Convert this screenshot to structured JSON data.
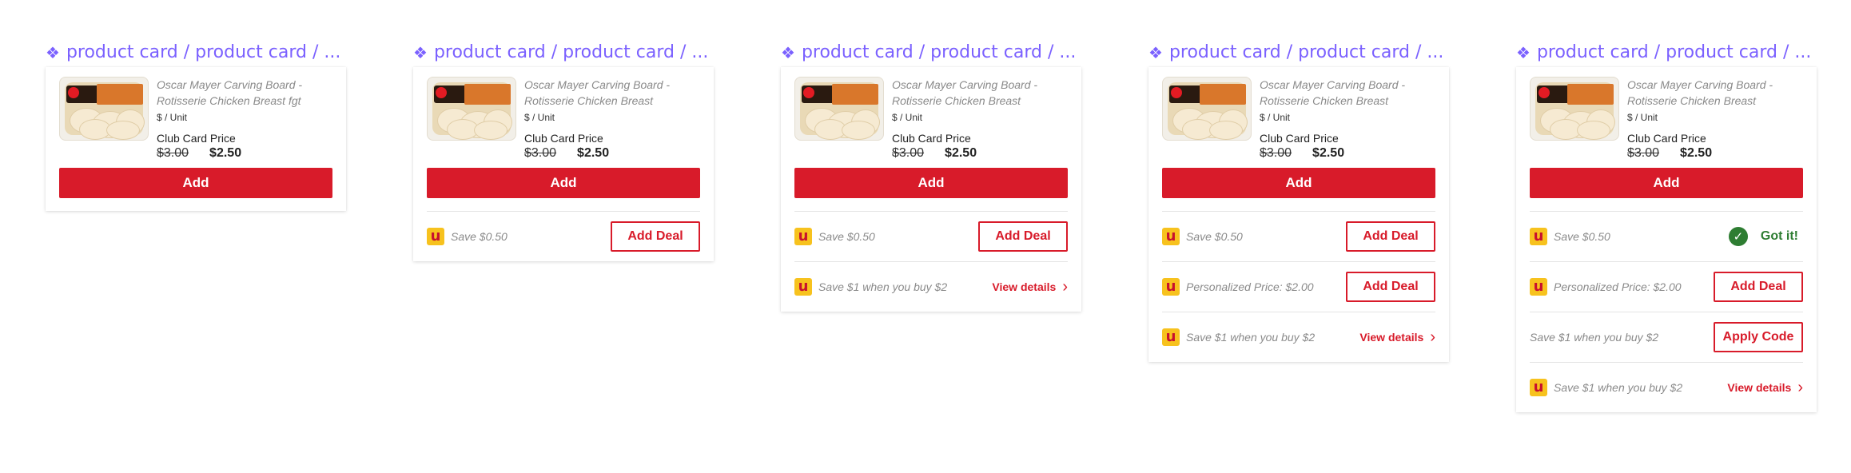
{
  "variant_title": "product card / product card / ...",
  "variants": [
    {
      "product": {
        "name": "Oscar Mayer Carving Board - Rotisserie Chicken Breast fgt",
        "unit": "$ / Unit",
        "club_label": "Club Card Price",
        "old_price": "$3.00",
        "new_price": "$2.50",
        "add_label": "Add"
      },
      "offers": []
    },
    {
      "product": {
        "name": "Oscar Mayer Carving Board - Rotisserie Chicken Breast",
        "unit": "$ / Unit",
        "club_label": "Club Card Price",
        "old_price": "$3.00",
        "new_price": "$2.50",
        "add_label": "Add"
      },
      "offers": [
        {
          "icon": "u-icon",
          "icon_glyph": "u",
          "text": "Save $0.50",
          "action": "button",
          "action_label": "Add Deal"
        }
      ]
    },
    {
      "product": {
        "name": "Oscar Mayer Carving Board - Rotisserie Chicken Breast",
        "unit": "$ / Unit",
        "club_label": "Club Card Price",
        "old_price": "$3.00",
        "new_price": "$2.50",
        "add_label": "Add"
      },
      "offers": [
        {
          "icon": "u-icon",
          "icon_glyph": "u",
          "text": "Save $0.50",
          "action": "button",
          "action_label": "Add Deal"
        },
        {
          "icon": "u-icon",
          "icon_glyph": "u",
          "text": "Save $1 when you buy $2",
          "action": "link",
          "action_label": "View details"
        }
      ]
    },
    {
      "product": {
        "name": "Oscar Mayer Carving Board - Rotisserie Chicken Breast",
        "unit": "$ / Unit",
        "club_label": "Club Card Price",
        "old_price": "$3.00",
        "new_price": "$2.50",
        "add_label": "Add"
      },
      "offers": [
        {
          "icon": "u-icon",
          "icon_glyph": "u",
          "text": "Save $0.50",
          "action": "button",
          "action_label": "Add Deal"
        },
        {
          "icon": "u-icon",
          "icon_glyph": "u",
          "text": "Personalized Price: $2.00",
          "action": "button",
          "action_label": "Add Deal"
        },
        {
          "icon": "u-icon",
          "icon_glyph": "u",
          "text": "Save $1 when you buy $2",
          "action": "link",
          "action_label": "View details"
        }
      ]
    },
    {
      "product": {
        "name": "Oscar Mayer Carving Board - Rotisserie Chicken Breast",
        "unit": "$ / Unit",
        "club_label": "Club Card Price",
        "old_price": "$3.00",
        "new_price": "$2.50",
        "add_label": "Add"
      },
      "offers": [
        {
          "icon": "u-icon",
          "icon_glyph": "u",
          "text": "Save $0.50",
          "action": "status",
          "action_label": "Got it!"
        },
        {
          "icon": "u-icon",
          "icon_glyph": "u",
          "text": "Personalized Price: $2.00",
          "action": "button",
          "action_label": "Add Deal"
        },
        {
          "icon": null,
          "text": "Save $1 when you buy $2",
          "action": "button",
          "action_label": "Apply Code"
        },
        {
          "icon": "u-icon",
          "icon_glyph": "u",
          "text": "Save $1 when you buy $2",
          "action": "link",
          "action_label": "View details"
        }
      ]
    }
  ],
  "colors": {
    "variant_title": "#7b61ff",
    "primary_red": "#d81b2a",
    "success_green": "#2e7d32",
    "u_icon_bg": "#f7c21e"
  }
}
